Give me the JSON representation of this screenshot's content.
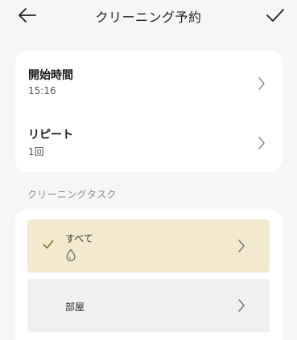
{
  "header": {
    "title": "クリーニング予約"
  },
  "settings": {
    "start_time": {
      "label": "開始時間",
      "value": "15:16"
    },
    "repeat": {
      "label": "リピート",
      "value": "1回"
    }
  },
  "tasks": {
    "section_label": "クリーニングタスク",
    "items": [
      {
        "label": "すべて",
        "selected": true,
        "icon": "water-drop-icon"
      },
      {
        "label": "部屋",
        "selected": false
      }
    ]
  },
  "colors": {
    "selected_bg": "#f3e9cf",
    "check": "#8a6d2a",
    "background": "#f6f6f4"
  }
}
